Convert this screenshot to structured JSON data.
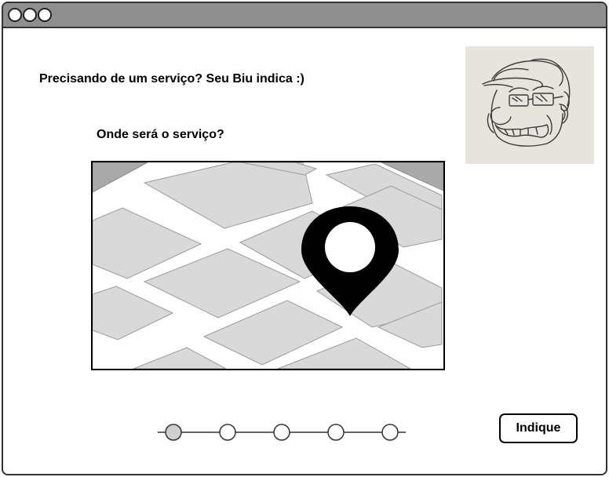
{
  "header": {
    "title": "Precisando de um serviço? Seu Biu indica :)"
  },
  "form": {
    "question": "Onde será o serviço?"
  },
  "stepper": {
    "total_steps": 5,
    "current_step": 1
  },
  "actions": {
    "submit_label": "Indique"
  },
  "colors": {
    "titlebar": "#8f8f8f",
    "map_block": "#d9d9d9",
    "map_corner": "#a9a9a9",
    "step_active": "#cfcfcf",
    "pin": "#000000"
  }
}
